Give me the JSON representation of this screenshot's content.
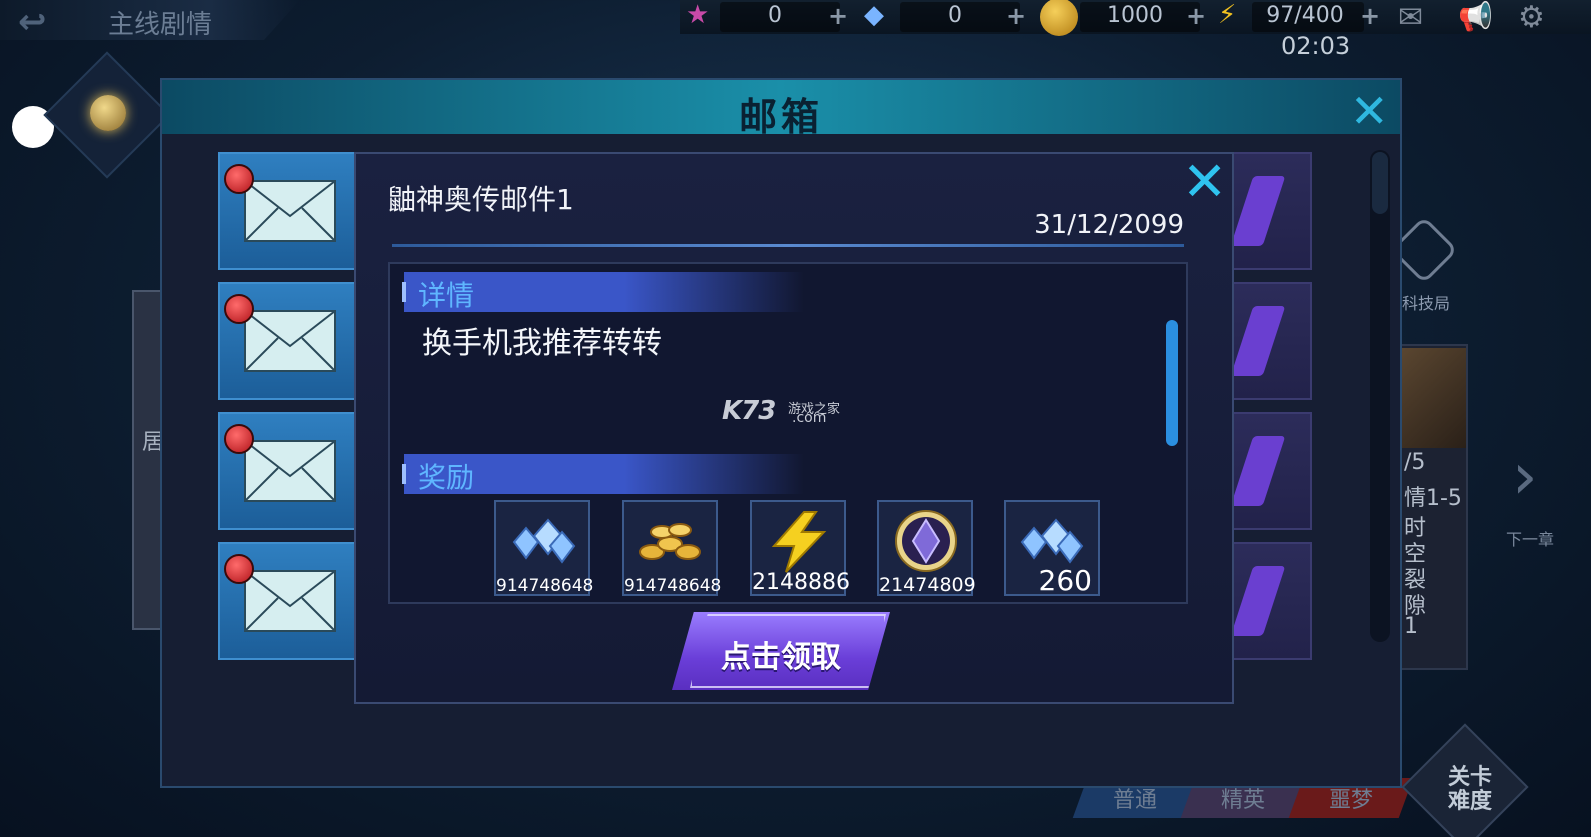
{
  "topbar": {
    "back_title": "主线剧情",
    "resources": [
      {
        "icon": "star-icon",
        "value": "0",
        "color": "#c84aa8"
      },
      {
        "icon": "diamond-icon",
        "value": "0",
        "color": "#7ab4ff"
      },
      {
        "icon": "gold-coin-icon",
        "value": "1000",
        "color": "#d8a224"
      },
      {
        "icon": "energy-bolt-icon",
        "value": "97/400",
        "color": "#f0c020"
      }
    ],
    "plus": "+",
    "clock": "02:03"
  },
  "mailbox": {
    "title": "邮箱",
    "close": "✕"
  },
  "mail_detail": {
    "title": "鼬神奥传邮件1",
    "date": "31/12/2099",
    "details_label": "详情",
    "details_text": "换手机我推荐转转",
    "rewards_label": "奖励",
    "rewards": [
      {
        "icon": "blue-diamond-pile-icon",
        "qty": "914748648"
      },
      {
        "icon": "gold-coin-pile-icon",
        "qty": "914748648"
      },
      {
        "icon": "lightning-icon",
        "qty": "2148886"
      },
      {
        "icon": "purple-crystal-orb-icon",
        "qty": "21474809"
      },
      {
        "icon": "blue-diamond-pile-icon",
        "qty": "260"
      }
    ],
    "claim_label": "点击领取",
    "close": "✕"
  },
  "watermark": {
    "brand": "K73",
    "cn": "游戏之家",
    "domain": ".com"
  },
  "background": {
    "tech_label": "科技局",
    "level_lines": [
      "/5",
      "情1-5",
      "时",
      "空",
      "裂",
      "隙",
      "1"
    ],
    "left_card_char": "居",
    "next_label": "下一章",
    "bottom_tabs": [
      "普通",
      "精英",
      "噩梦"
    ],
    "difficulty": "关卡难度"
  }
}
